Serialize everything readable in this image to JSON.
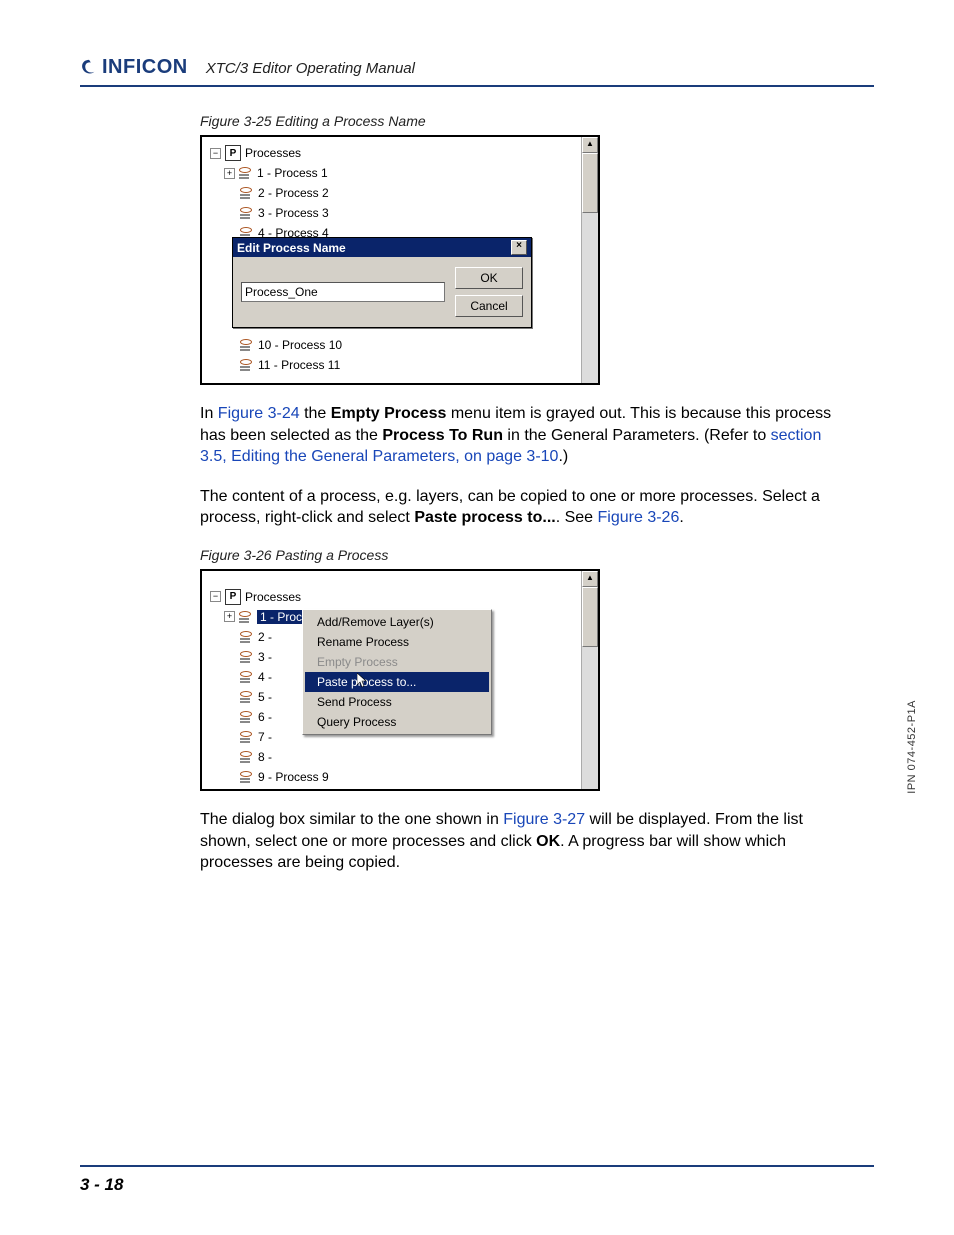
{
  "header": {
    "brand": "INFICON",
    "manual_title": "XTC/3 Editor Operating Manual"
  },
  "figure25": {
    "caption": "Figure 3-25  Editing a Process Name",
    "tree_root": "Processes",
    "items": [
      "1 - Process 1",
      "2 - Process 2",
      "3 - Process 3",
      "4 - Process 4"
    ],
    "items_after": [
      "10 - Process 10",
      "11 - Process 11"
    ],
    "dialog": {
      "title": "Edit Process Name",
      "input_value": "Process_One",
      "ok": "OK",
      "cancel": "Cancel"
    }
  },
  "para1": {
    "pre": "In ",
    "link1": "Figure 3-24",
    "mid1": " the ",
    "bold1": "Empty Process",
    "mid2": " menu item is grayed out. This is because this process has been selected as the ",
    "bold2": "Process To Run",
    "mid3": " in the General Parameters. (Refer to ",
    "link2": "section 3.5, Editing the General Parameters, on page 3-10",
    "end": ".)"
  },
  "para2": {
    "line1": "The content of a process, e.g. layers, can be copied to one or more processes. Select a process, right-click and select ",
    "bold": "Paste process to...",
    "mid": ". See ",
    "link": "Figure 3-26",
    "end": "."
  },
  "figure26": {
    "caption": "Figure 3-26  Pasting a Process",
    "tree_root": "Processes",
    "selected": "1 - Process_One",
    "nums": [
      "2 -",
      "3 -",
      "4 -",
      "5 -",
      "6 -",
      "7 -",
      "8 -"
    ],
    "after": "9 - Process 9",
    "context_menu": [
      {
        "label": "Add/Remove Layer(s)",
        "state": "normal"
      },
      {
        "label": "Rename Process",
        "state": "normal"
      },
      {
        "label": "Empty Process",
        "state": "disabled"
      },
      {
        "label": "Paste process to...",
        "state": "selected"
      },
      {
        "label": "Send Process",
        "state": "normal"
      },
      {
        "label": "Query Process",
        "state": "normal"
      }
    ]
  },
  "para3": {
    "pre": "The dialog box similar to the one shown in ",
    "link": "Figure 3-27",
    "mid": " will be displayed. From the list shown, select one or more processes and click ",
    "bold": "OK",
    "end": ". A progress bar will show which processes are being copied."
  },
  "footer": {
    "page": "3 - 18",
    "ipn": "IPN 074-452-P1A"
  }
}
